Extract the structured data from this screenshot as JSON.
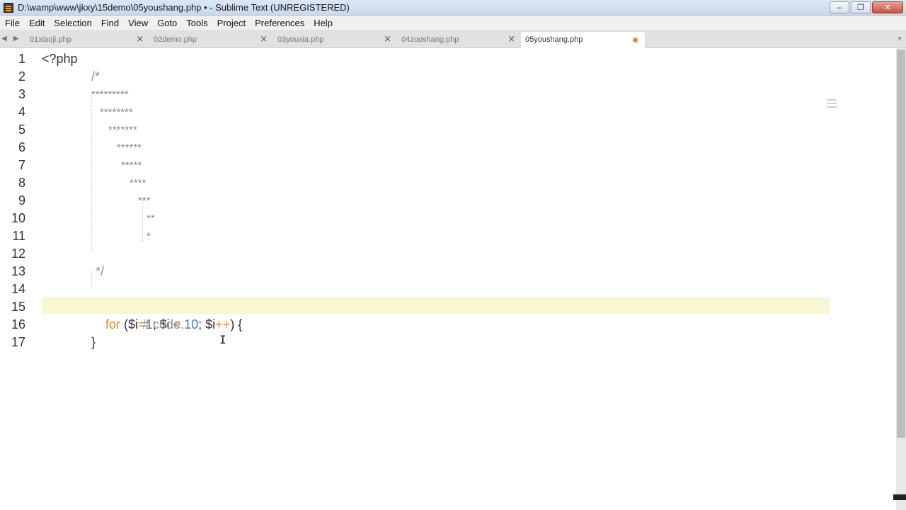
{
  "window": {
    "title": "D:\\wamp\\www\\jkxy\\15demo\\05youshang.php • - Sublime Text (UNREGISTERED)",
    "minimize": "‒",
    "maximize": "❐",
    "close": "✕"
  },
  "menu": [
    "File",
    "Edit",
    "Selection",
    "Find",
    "View",
    "Goto",
    "Tools",
    "Project",
    "Preferences",
    "Help"
  ],
  "tabs": [
    {
      "label": "01xiaoji.php",
      "close": "×"
    },
    {
      "label": "02demo.php",
      "close": "×"
    },
    {
      "label": "03youxia.php",
      "close": "×"
    },
    {
      "label": "04zuoshang.php",
      "close": "×"
    },
    {
      "label": "05youshang.php",
      "active": true,
      "dirty": true
    }
  ],
  "tab_nav": "◀ ▶",
  "tabbar_right": "▼",
  "editor": {
    "line_numbers": [
      "1",
      "2",
      "3",
      "4",
      "5",
      "6",
      "7",
      "8",
      "9",
      "10",
      "11",
      "12",
      "13",
      "14",
      "15",
      "16",
      "17"
    ],
    "current_line": 15,
    "lines": {
      "l1": "<?php",
      "l2": "/*",
      "l3": "*********",
      "l4": "********",
      "l5": "*******",
      "l6": "******",
      "l7": "*****",
      "l8": "****",
      "l9": "***",
      "l10": "**",
      "l11": "*",
      "l13": "*/",
      "l15": {
        "kw": "for",
        "open": " ($i",
        "eq": "=",
        "one": "1",
        "semi1": "; $i ",
        "lt": "<",
        "sp": " ",
        "ten": "10",
        "semi2": "; $i",
        "inc": "++",
        "close": ") {"
      },
      "l16": "# code...",
      "l17": "}"
    }
  },
  "colors": {
    "keyword": "#e8861c",
    "number": "#4e73c4",
    "comment": "#8d8d8d",
    "current_line_bg": "#f7f7d2"
  }
}
